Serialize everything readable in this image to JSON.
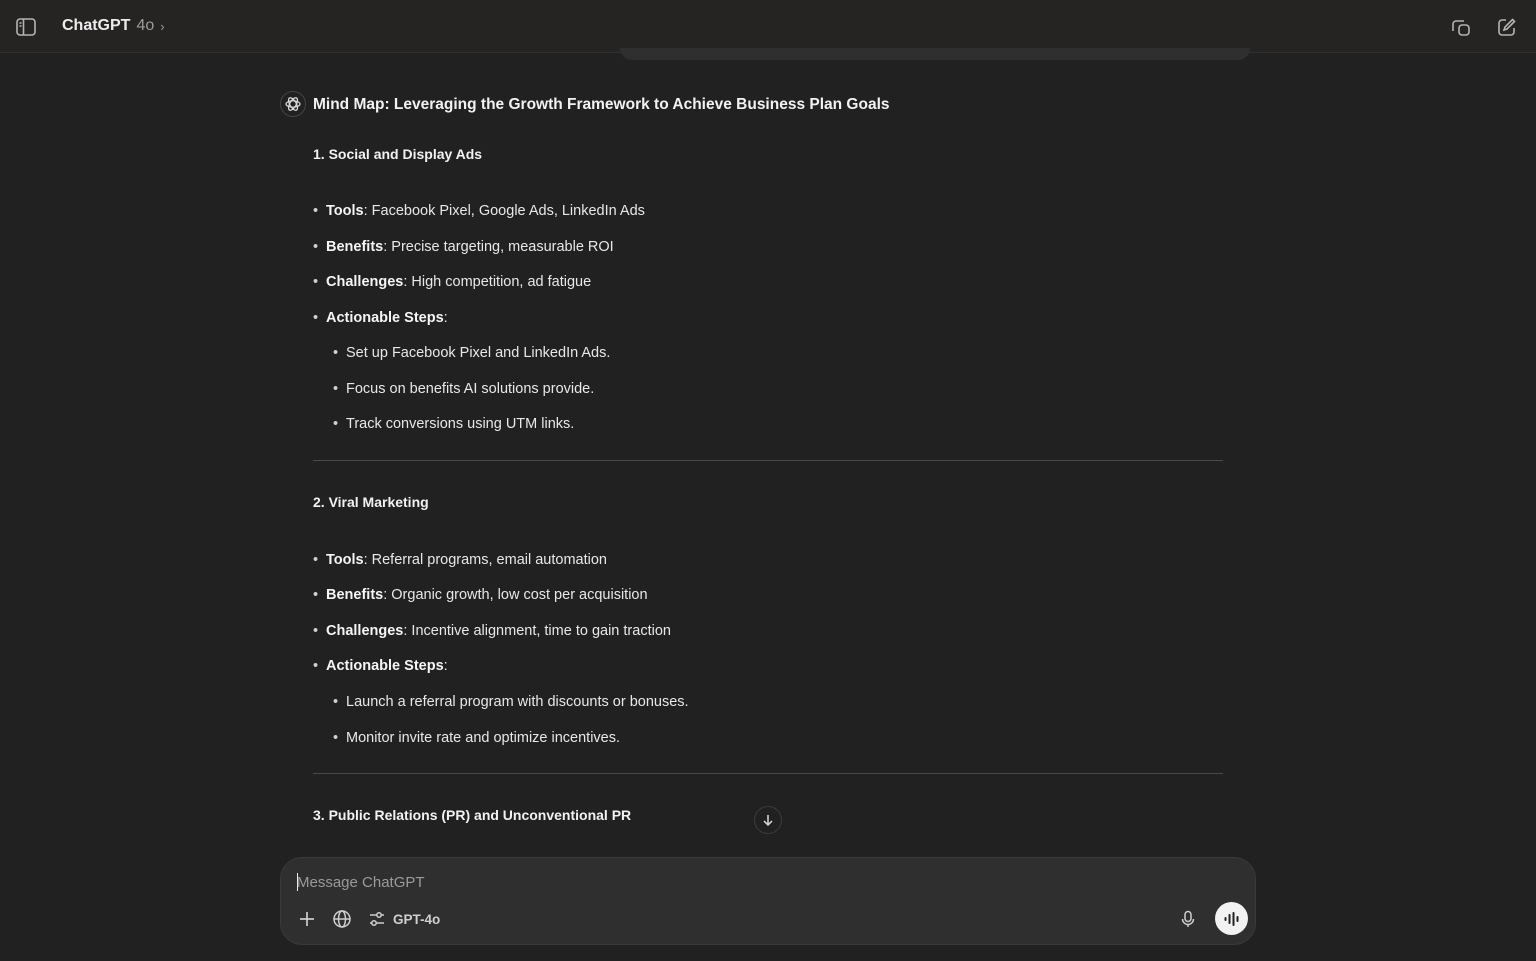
{
  "header": {
    "brand": "ChatGPT",
    "model_version": "4o",
    "chevron": "›"
  },
  "message": {
    "title": "Mind Map: Leveraging the Growth Framework to Achieve Business Plan Goals",
    "sections": [
      {
        "heading": "1. Social and Display Ads",
        "items": [
          {
            "label": "Tools",
            "text": ": Facebook Pixel, Google Ads, LinkedIn Ads"
          },
          {
            "label": "Benefits",
            "text": ": Precise targeting, measurable ROI"
          },
          {
            "label": "Challenges",
            "text": ": High competition, ad fatigue"
          },
          {
            "label": "Actionable Steps",
            "text": ":"
          }
        ],
        "steps": [
          "Set up Facebook Pixel and LinkedIn Ads.",
          "Focus on benefits AI solutions provide.",
          "Track conversions using UTM links."
        ]
      },
      {
        "heading": "2. Viral Marketing",
        "items": [
          {
            "label": "Tools",
            "text": ": Referral programs, email automation"
          },
          {
            "label": "Benefits",
            "text": ": Organic growth, low cost per acquisition"
          },
          {
            "label": "Challenges",
            "text": ": Incentive alignment, time to gain traction"
          },
          {
            "label": "Actionable Steps",
            "text": ":"
          }
        ],
        "steps": [
          "Launch a referral program with discounts or bonuses.",
          "Monitor invite rate and optimize incentives."
        ]
      },
      {
        "heading": "3. Public Relations (PR) and Unconventional PR"
      }
    ]
  },
  "composer": {
    "placeholder": "Message ChatGPT",
    "value": "",
    "model_tool_label": "GPT-4o"
  },
  "icons": {
    "sidebar_toggle": "sidebar-toggle-icon",
    "temporary_chat": "temporary-chat-icon",
    "new_chat": "new-chat-icon",
    "avatar": "openai-logo-icon",
    "scroll_down": "arrow-down-icon",
    "attach": "plus-icon",
    "search": "globe-icon",
    "tools": "sliders-icon",
    "mic": "microphone-icon",
    "voice": "voice-mode-icon"
  }
}
